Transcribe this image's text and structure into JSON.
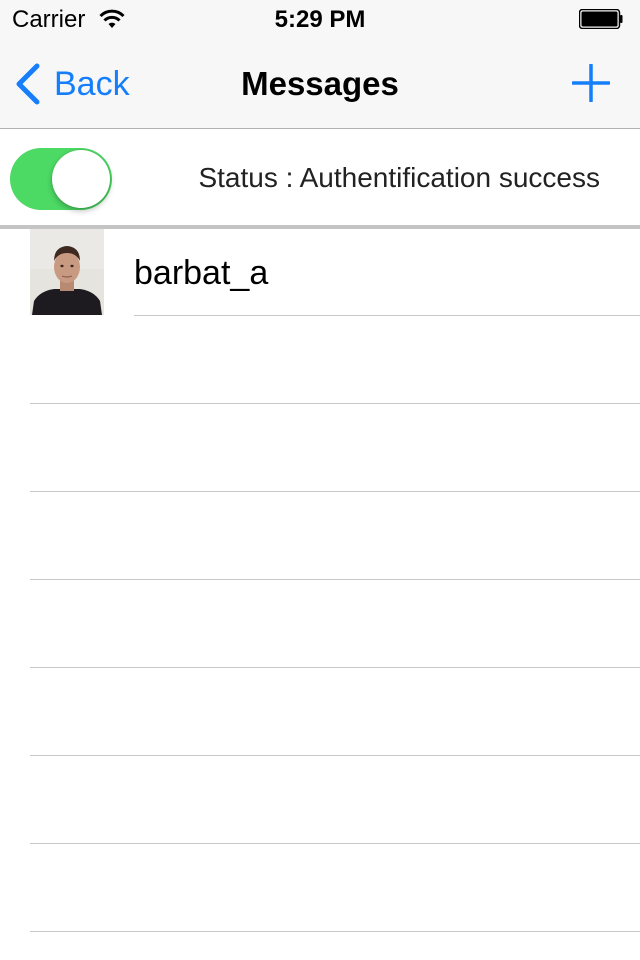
{
  "status_bar": {
    "carrier": "Carrier",
    "time": "5:29 PM",
    "wifi_icon": "wifi-icon",
    "battery_icon": "battery-full-icon"
  },
  "nav": {
    "back_label": "Back",
    "title": "Messages",
    "back_icon": "chevron-left-icon",
    "add_icon": "plus-icon"
  },
  "status": {
    "toggle_on": true,
    "text": "Status : Authentification success"
  },
  "contacts": [
    {
      "name": "barbat_a"
    }
  ],
  "colors": {
    "accent": "#147efb",
    "toggle_on": "#4cd964",
    "separator": "#c8c7cc",
    "nav_bg": "#f7f7f7"
  }
}
